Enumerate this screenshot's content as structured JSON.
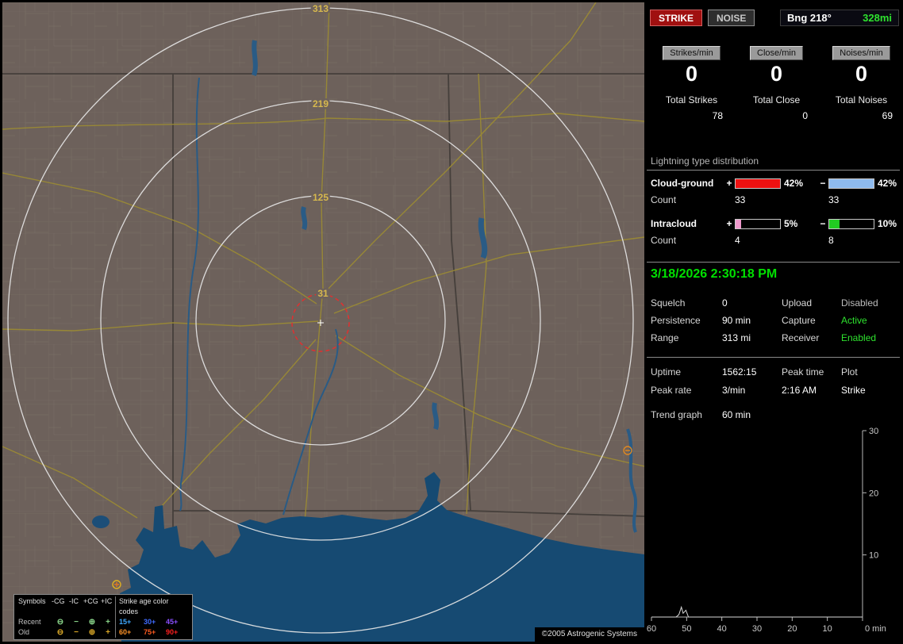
{
  "header": {
    "strike_button": "STRIKE",
    "noise_button": "NOISE",
    "bearing": "Bng 218°",
    "bearing_range": "328mi"
  },
  "counters": {
    "columns": [
      {
        "button_label": "Strikes/min",
        "rate": "0",
        "total_label": "Total Strikes",
        "total_value": "78"
      },
      {
        "button_label": "Close/min",
        "rate": "0",
        "total_label": "Total Close",
        "total_value": "0"
      },
      {
        "button_label": "Noises/min",
        "rate": "0",
        "total_label": "Total Noises",
        "total_value": "69"
      }
    ]
  },
  "distribution": {
    "title": "Lightning type distribution",
    "bar_scale_max": 42,
    "rows": [
      {
        "label": "Cloud-ground",
        "plus_sign": "+",
        "plus_pct": "42%",
        "plus_pct_num": 42,
        "plus_color": "#ee1111",
        "minus_sign": "−",
        "minus_pct": "42%",
        "minus_pct_num": 42,
        "minus_color": "#8fbbee",
        "count_label": "Count",
        "plus_count": "33",
        "minus_count": "33"
      },
      {
        "label": "Intracloud",
        "plus_sign": "+",
        "plus_pct": "5%",
        "plus_pct_num": 5,
        "plus_color": "#ee99cc",
        "minus_sign": "−",
        "minus_pct": "10%",
        "minus_pct_num": 10,
        "minus_color": "#22cc22",
        "count_label": "Count",
        "plus_count": "4",
        "minus_count": "8"
      }
    ]
  },
  "status": {
    "datetime": "3/18/2026 2:30:18 PM",
    "rows": [
      {
        "label1": "Squelch",
        "value1": "0",
        "label2": "Upload",
        "value2": "Disabled",
        "value2_state": "disabled"
      },
      {
        "label1": "Persistence",
        "value1": "90 min",
        "label2": "Capture",
        "value2": "Active",
        "value2_state": "active"
      },
      {
        "label1": "Range",
        "value1": "313 mi",
        "label2": "Receiver",
        "value2": "Enabled",
        "value2_state": "active"
      }
    ]
  },
  "stats": {
    "row1": {
      "label1": "Uptime",
      "value1": "1562:15",
      "label2": "Peak time",
      "label3": "Plot"
    },
    "row2": {
      "label1": "Peak rate",
      "value1": "3/min",
      "value2": "2:16 AM",
      "value3": "Strike"
    },
    "trend_label": "Trend graph",
    "trend_value": "60 min"
  },
  "chart_data": {
    "type": "line",
    "x_axis_direction": "60 min ago at left, now at right",
    "x_ticks": [
      60,
      50,
      40,
      30,
      20,
      10,
      0
    ],
    "x_last_tick_label": "0 min",
    "x_unit": "min",
    "ylim": [
      0,
      30
    ],
    "y_ticks": [
      10,
      20,
      30
    ],
    "y_axis_side": "right",
    "grid": false,
    "series": [
      {
        "name": "strike-rate-trend",
        "points": [
          [
            60,
            0
          ],
          [
            53,
            0
          ],
          [
            52.2,
            0.4
          ],
          [
            51.5,
            1.6
          ],
          [
            51,
            0.6
          ],
          [
            50.2,
            1.1
          ],
          [
            49.5,
            0
          ],
          [
            0,
            0
          ]
        ]
      }
    ]
  },
  "map": {
    "ring_labels": [
      "313",
      "219",
      "125",
      "31"
    ],
    "copyright": "©2005 Astrogenic Systems"
  },
  "legend": {
    "symbols_title": "Symbols",
    "symbol_headers": [
      "-CG",
      "-IC",
      "+CG",
      "+IC"
    ],
    "age_title": "Strike age color codes",
    "rows": [
      {
        "label": "Recent",
        "symbols": [
          "⊖",
          "−",
          "⊕",
          "+"
        ],
        "symbol_color": "#89d489",
        "ages": [
          {
            "text": "15+",
            "color": "#3fa9ff"
          },
          {
            "text": "30+",
            "color": "#3f6bff"
          },
          {
            "text": "45+",
            "color": "#8a4fff"
          }
        ]
      },
      {
        "label": "Old",
        "symbols": [
          "⊖",
          "−",
          "⊕",
          "+"
        ],
        "symbol_color": "#d9a727",
        "ages": [
          {
            "text": "60+",
            "color": "#ff9326"
          },
          {
            "text": "75+",
            "color": "#ff5b1f"
          },
          {
            "text": "90+",
            "color": "#ff1f1f"
          }
        ]
      }
    ]
  }
}
